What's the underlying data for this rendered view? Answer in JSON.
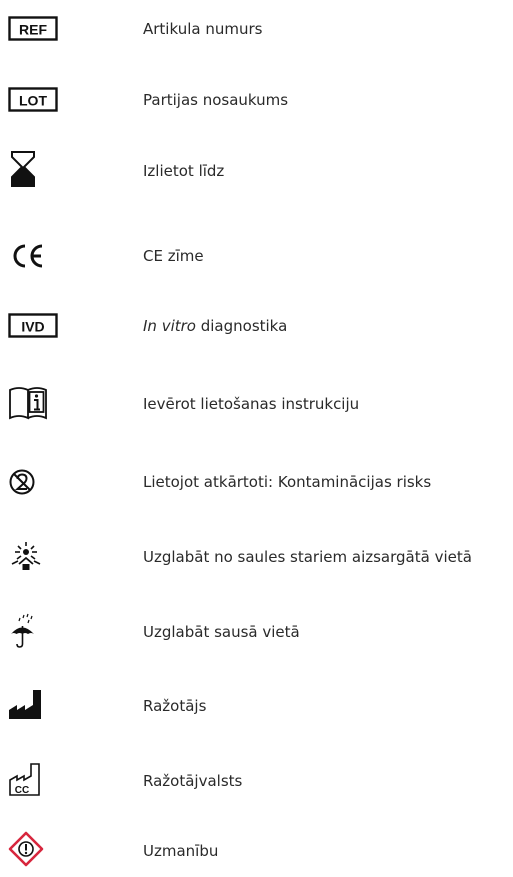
{
  "symbols": [
    {
      "icon": "ref-icon",
      "code": "REF",
      "label": "Artikula numurs"
    },
    {
      "icon": "lot-icon",
      "code": "LOT",
      "label": "Partijas nosaukums"
    },
    {
      "icon": "hourglass-icon",
      "label": "Izlietot līdz"
    },
    {
      "icon": "ce-mark-icon",
      "code": "CE",
      "label": "CE zīme"
    },
    {
      "icon": "ivd-icon",
      "code": "IVD",
      "label_italic": "In vitro",
      "label_rest": " diagnostika"
    },
    {
      "icon": "instructions-icon",
      "label": "Ievērot lietošanas instrukciju"
    },
    {
      "icon": "do-not-reuse-icon",
      "label": "Lietojot atkārtoti: Kontaminācijas risks"
    },
    {
      "icon": "keep-away-from-sunlight-icon",
      "label": "Uzglabāt no saules stariem aizsargātā vietā"
    },
    {
      "icon": "keep-dry-icon",
      "label": "Uzglabāt sausā vietā"
    },
    {
      "icon": "manufacturer-icon",
      "label": "Ražotājs"
    },
    {
      "icon": "country-of-manufacture-icon",
      "code": "CC",
      "label": "Ražotājvalsts"
    },
    {
      "icon": "warning-icon",
      "label": "Uzmanību"
    }
  ]
}
